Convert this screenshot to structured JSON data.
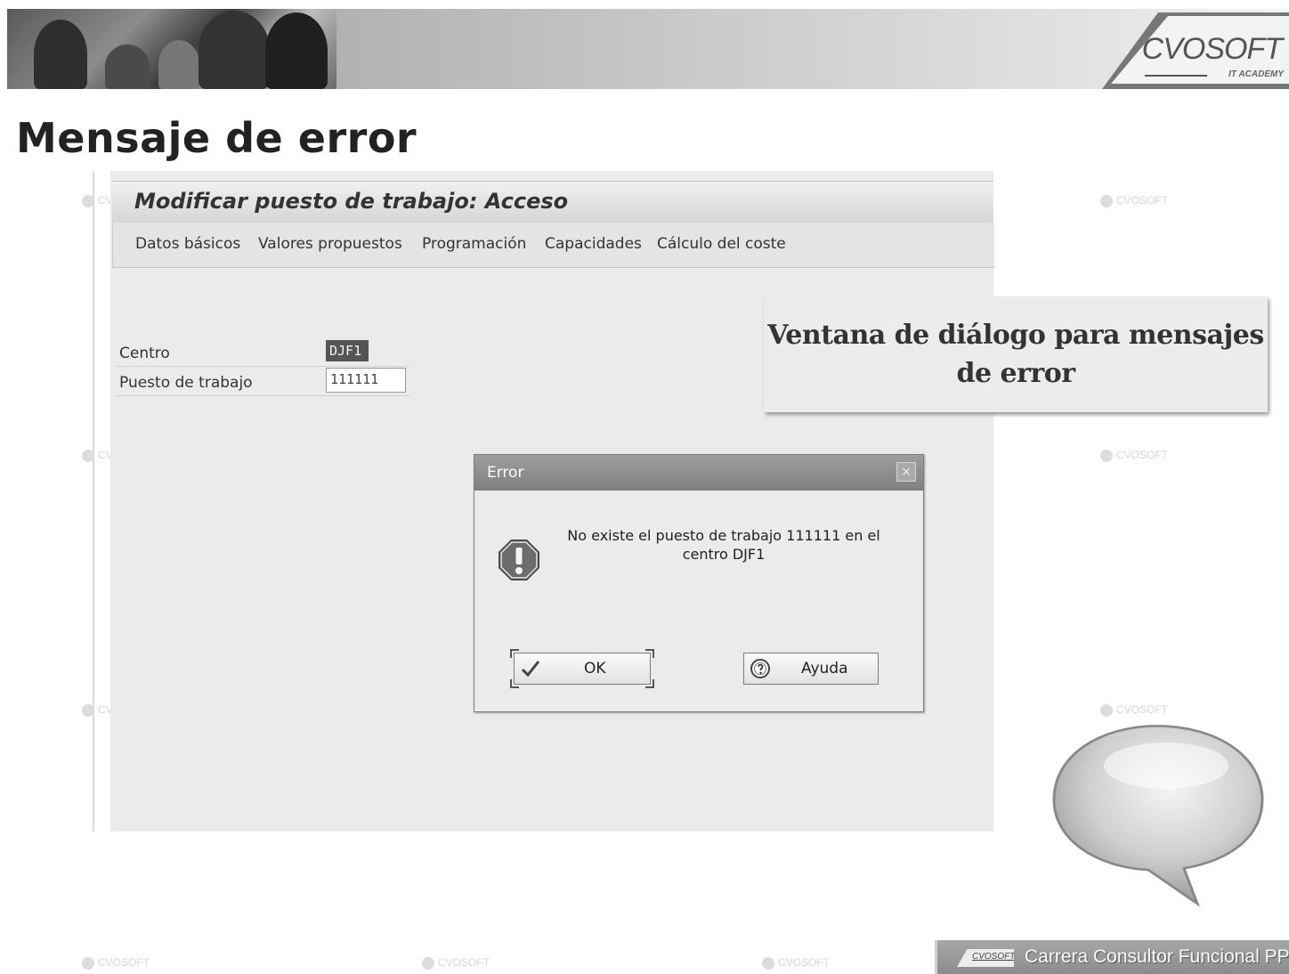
{
  "brand": {
    "name": "CVOSOFT",
    "tagline": "IT ACADEMY"
  },
  "page": {
    "title": "Mensaje de error"
  },
  "sap": {
    "window_title": "Modificar puesto de trabajo: Acceso",
    "menu": [
      {
        "label": "Datos básicos"
      },
      {
        "label": "Valores propuestos"
      },
      {
        "label": "Programación"
      },
      {
        "label": "Capacidades"
      },
      {
        "label": "Cálculo del coste"
      }
    ],
    "fields": {
      "centro": {
        "label": "Centro",
        "value": "DJF1"
      },
      "puesto": {
        "label": "Puesto de trabajo",
        "value": "111111"
      }
    }
  },
  "callout": {
    "text": "Ventana de diálogo para mensajes de error"
  },
  "dialog": {
    "title": "Error",
    "close_glyph": "×",
    "icon": "error-icon",
    "message": "No existe el puesto de trabajo 111111 en el centro DJF1",
    "ok_label": "OK",
    "help_label": "Ayuda"
  },
  "watermark": {
    "text": "CVOSOFT"
  },
  "footer": {
    "logo_text": "CVOSOFT",
    "text": "Carrera Consultor Funcional PP"
  },
  "colors": {
    "window_bg": "#ebebeb",
    "dialog_title": "#8c8c8c",
    "page_title": "#222222"
  }
}
